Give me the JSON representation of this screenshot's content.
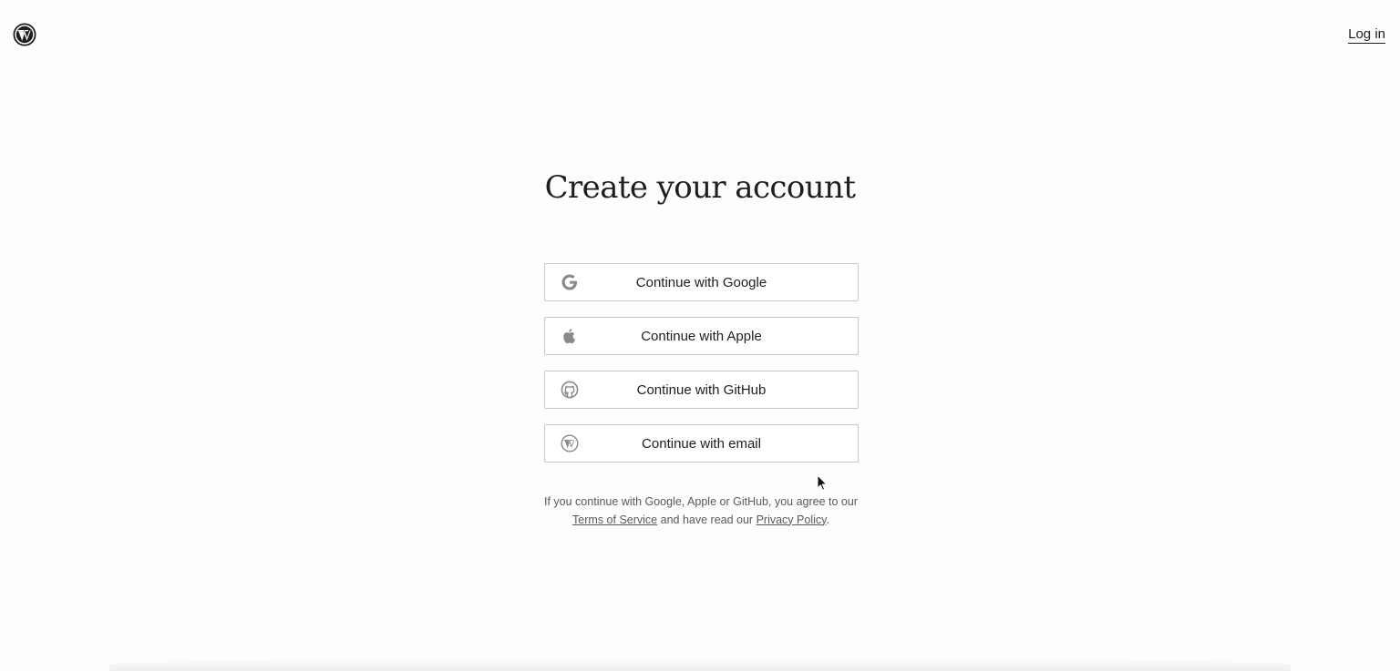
{
  "header": {
    "logo_icon": "wordpress-logo-icon",
    "login_label": "Log in"
  },
  "main": {
    "title": "Create your account",
    "buttons": [
      {
        "label": "Continue with Google",
        "icon": "google-icon"
      },
      {
        "label": "Continue with Apple",
        "icon": "apple-icon"
      },
      {
        "label": "Continue with GitHub",
        "icon": "github-icon"
      },
      {
        "label": "Continue with email",
        "icon": "wordpress-icon"
      }
    ],
    "terms": {
      "prefix": "If you continue with Google, Apple or GitHub, you agree to our",
      "tos_link": "Terms of Service",
      "middle": "and have read our",
      "privacy_link": "Privacy Policy",
      "suffix": "."
    }
  },
  "colors": {
    "background": "#fdfdfd",
    "text": "#1e1e1e",
    "muted_text": "#5a5a5a",
    "button_border": "#c8c8c8",
    "icon_gray": "#8a8a8a"
  }
}
